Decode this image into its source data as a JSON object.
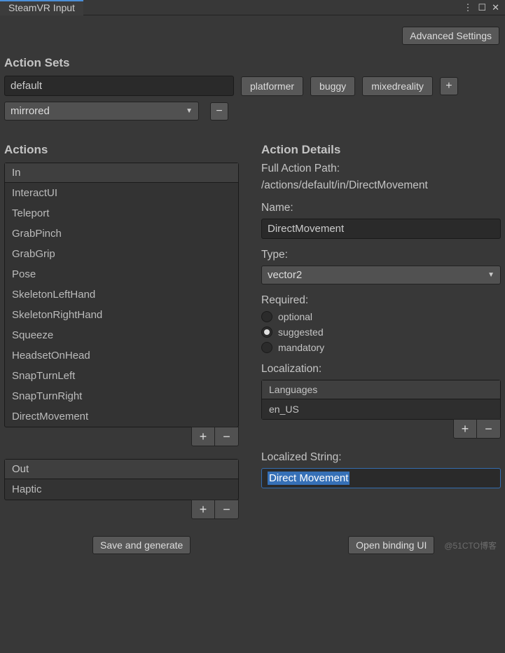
{
  "window": {
    "title": "SteamVR Input"
  },
  "toolbar": {
    "advanced": "Advanced Settings"
  },
  "actionSets": {
    "title": "Action Sets",
    "current": "default",
    "others": [
      "platformer",
      "buggy",
      "mixedreality"
    ],
    "mirrorMode": "mirrored"
  },
  "actions": {
    "title": "Actions",
    "inHeader": "In",
    "inItems": [
      "InteractUI",
      "Teleport",
      "GrabPinch",
      "GrabGrip",
      "Pose",
      "SkeletonLeftHand",
      "SkeletonRightHand",
      "Squeeze",
      "HeadsetOnHead",
      "SnapTurnLeft",
      "SnapTurnRight",
      "DirectMovement"
    ],
    "outHeader": "Out",
    "outItems": [
      "Haptic"
    ]
  },
  "details": {
    "title": "Action Details",
    "fullPathLabel": "Full Action Path:",
    "fullPath": "/actions/default/in/DirectMovement",
    "nameLabel": "Name:",
    "name": "DirectMovement",
    "typeLabel": "Type:",
    "type": "vector2",
    "requiredLabel": "Required:",
    "requiredOptions": [
      "optional",
      "suggested",
      "mandatory"
    ],
    "requiredSelected": "suggested",
    "locLabel": "Localization:",
    "locHeader": "Languages",
    "locItems": [
      "en_US"
    ],
    "locStrLabel": "Localized String:",
    "locStr": "Direct Movement"
  },
  "footer": {
    "save": "Save and generate",
    "open": "Open binding UI",
    "watermark": "@51CTO博客"
  }
}
